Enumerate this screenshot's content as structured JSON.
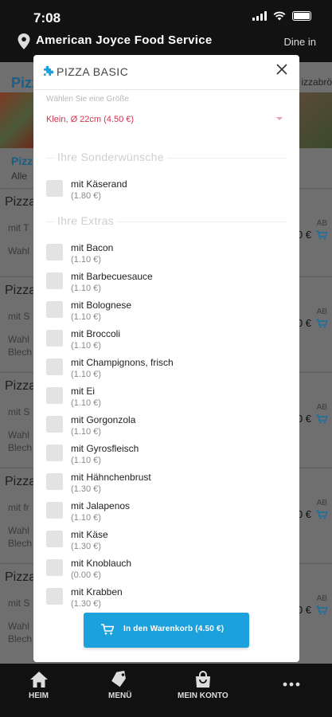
{
  "status_bar": {
    "time": "7:08"
  },
  "header": {
    "title": "American Joyce Food Service",
    "mode": "Dine in"
  },
  "background": {
    "category_title": "Pizz",
    "right_title": "izzabrö",
    "pizza_label": "Pizz",
    "alle_label": "Alle",
    "rows": [
      {
        "name": "Pizza",
        "line1": "mit T",
        "line2": "Wahl",
        "line3": "",
        "ab": "AB",
        "price": "0 €"
      },
      {
        "name": "Pizza",
        "line1": "mit S",
        "line2": "Wahl",
        "line3": "Blech",
        "ab": "AB",
        "price": "0 €"
      },
      {
        "name": "Pizza",
        "line1": "mit S",
        "line2": "Wahl",
        "line3": "Blech",
        "ab": "AB",
        "price": "0 €"
      },
      {
        "name": "Pizza",
        "line1": "mit fr",
        "line2": "Wahl",
        "line3": "Blech",
        "ab": "AB",
        "price": "0 €"
      },
      {
        "name": "Pizza",
        "line1": "mit S",
        "line2": "Wahl",
        "line3": "Blech",
        "ab": "AB",
        "price": "0 €"
      }
    ]
  },
  "modal": {
    "title": "PIZZA BASIC",
    "size_label": "Wählen Sie eine Größe",
    "size_value": "Klein, Ø 22cm (4.50 €)",
    "section_sonder": "Ihre Sonderwünsche",
    "section_extras": "Ihre Extras",
    "sonder_options": [
      {
        "name": "mit Käserand",
        "price": "(1.80 €)"
      }
    ],
    "extras": [
      {
        "name": "mit Bacon",
        "price": "(1.10 €)"
      },
      {
        "name": "mit Barbecuesauce",
        "price": "(1.10 €)"
      },
      {
        "name": "mit Bolognese",
        "price": "(1.10 €)"
      },
      {
        "name": "mit Broccoli",
        "price": "(1.10 €)"
      },
      {
        "name": "mit Champignons, frisch",
        "price": "(1.10 €)"
      },
      {
        "name": "mit Ei",
        "price": "(1.10 €)"
      },
      {
        "name": "mit Gorgonzola",
        "price": "(1.10 €)"
      },
      {
        "name": "mit Gyrosfleisch",
        "price": "(1.10 €)"
      },
      {
        "name": "mit Hähnchenbrust",
        "price": "(1.30 €)"
      },
      {
        "name": "mit Jalapenos",
        "price": "(1.10 €)"
      },
      {
        "name": "mit Käse",
        "price": "(1.30 €)"
      },
      {
        "name": "mit Knoblauch",
        "price": "(0.00 €)"
      },
      {
        "name": "mit Krabben",
        "price": "(1.30 €)"
      }
    ],
    "cart_button": "In den Warenkorb (4.50 €)"
  },
  "bottom_nav": {
    "home": "HEIM",
    "menu": "MENÜ",
    "account": "MEIN KONTO"
  },
  "colors": {
    "accent": "#1da1dc",
    "price_red": "#d6314b",
    "brand_blue": "#1b5f86"
  }
}
